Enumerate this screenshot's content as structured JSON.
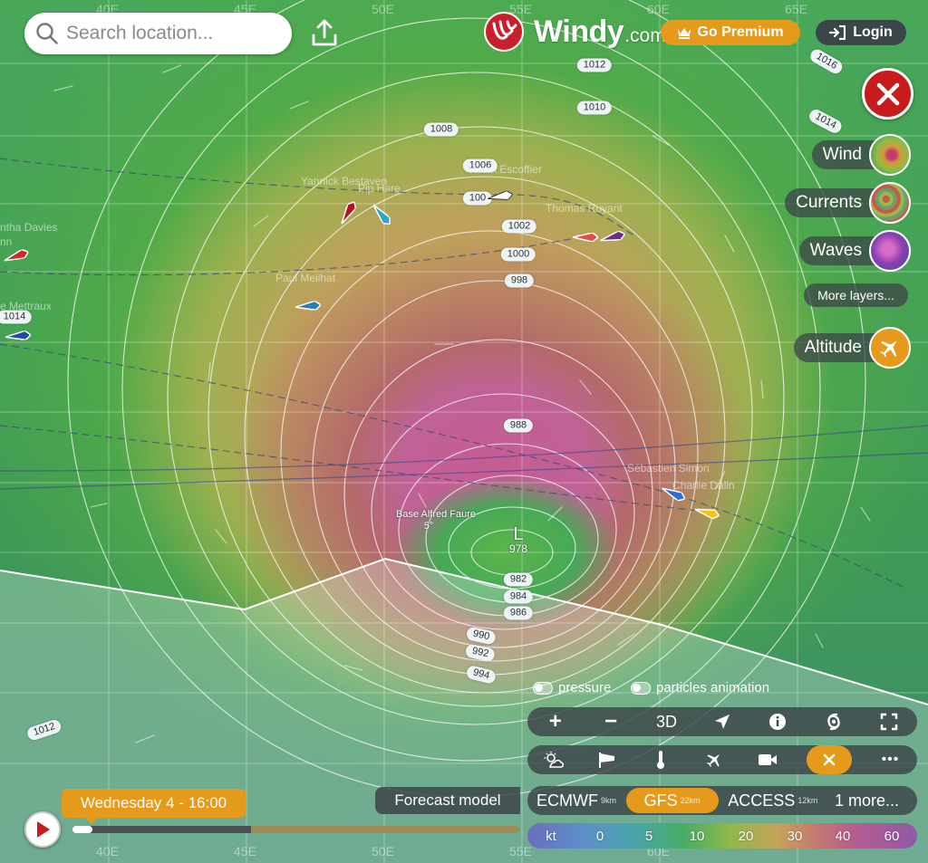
{
  "search": {
    "placeholder": "Search location..."
  },
  "header": {
    "logo_text": "Windy",
    "logo_domain": ".com",
    "premium_label": "Go Premium",
    "login_label": "Login"
  },
  "layers": {
    "items": [
      {
        "label": "Wind",
        "icon": "wind-thumbnail"
      },
      {
        "label": "Currents",
        "icon": "currents-thumbnail"
      },
      {
        "label": "Waves",
        "icon": "waves-thumbnail"
      }
    ],
    "more_label": "More layers...",
    "altitude_label": "Altitude"
  },
  "map": {
    "grid_labels": [
      "40E",
      "45E",
      "50E",
      "55E",
      "60E",
      "65E"
    ],
    "isobars": [
      "1016",
      "1012",
      "1010",
      "1014",
      "1008",
      "1006",
      "100",
      "1002",
      "1000",
      "998",
      "988",
      "978",
      "982",
      "984",
      "986",
      "990",
      "992",
      "994",
      "1014",
      "1012"
    ],
    "boats": [
      "Yannick Bestaven",
      "Pip Hare",
      "Kevin Escoffier",
      "Thomas Ruyant",
      "Paul Meilhat",
      "ntha Davies",
      "nn",
      "e Mettraux",
      "Sébastien Simon",
      "Charlie Dalin"
    ],
    "place_name": "Base Alfred Faure",
    "place_temp": "5°",
    "low_marker": "L",
    "low_pressure": "978"
  },
  "toggles": {
    "pressure": "pressure",
    "particles": "particles animation"
  },
  "toolbar": {
    "plus": "+",
    "minus": "−",
    "mode_3d": "3D",
    "more": "•••"
  },
  "models": {
    "label": "Forecast model",
    "items": [
      {
        "name": "ECMWF",
        "res": "9km"
      },
      {
        "name": "GFS",
        "res": "22km"
      },
      {
        "name": "ACCESS",
        "res": "12km"
      }
    ],
    "more": "1 more...",
    "active": "GFS"
  },
  "scale": {
    "unit": "kt",
    "ticks": [
      "0",
      "5",
      "10",
      "20",
      "30",
      "40",
      "60"
    ]
  },
  "timeline": {
    "current": "Wednesday 4 - 16:00",
    "progress": 0.4
  },
  "colors": {
    "accent": "#e69a1b",
    "close": "#c81b1b",
    "panel": "#3c4549"
  }
}
